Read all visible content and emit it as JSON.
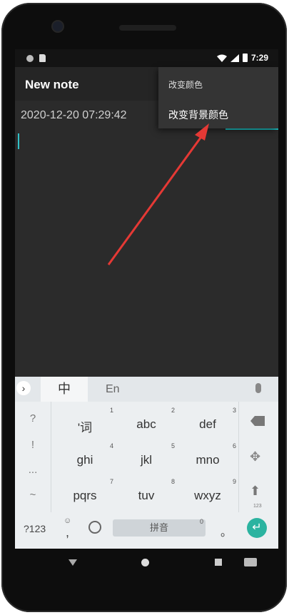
{
  "status": {
    "time": "7:29"
  },
  "app": {
    "title": "New note"
  },
  "note": {
    "timestamp": "2020-12-20 07:29:42"
  },
  "menu": {
    "items": [
      {
        "label": "改变颜色"
      },
      {
        "label": "改变背景颜色"
      }
    ]
  },
  "keyboard": {
    "tab_cn": "中",
    "tab_en": "En",
    "left_keys": [
      "?",
      "!",
      "...",
      "~"
    ],
    "keys": [
      {
        "label": "'词",
        "num": "1"
      },
      {
        "label": "abc",
        "num": "2"
      },
      {
        "label": "def",
        "num": "3"
      },
      {
        "label": "ghi",
        "num": "4"
      },
      {
        "label": "jkl",
        "num": "5"
      },
      {
        "label": "mno",
        "num": "6"
      },
      {
        "label": "pqrs",
        "num": "7"
      },
      {
        "label": "tuv",
        "num": "8"
      },
      {
        "label": "wxyz",
        "num": "9"
      }
    ],
    "shift_sub": "123",
    "symbols_key": "?123",
    "comma": ",",
    "space_label": "拼音",
    "space_num": "0",
    "period": "。"
  },
  "colors": {
    "accent": "#1ec9cc",
    "arrow": "#e53935",
    "enter": "#2bb3a0"
  }
}
